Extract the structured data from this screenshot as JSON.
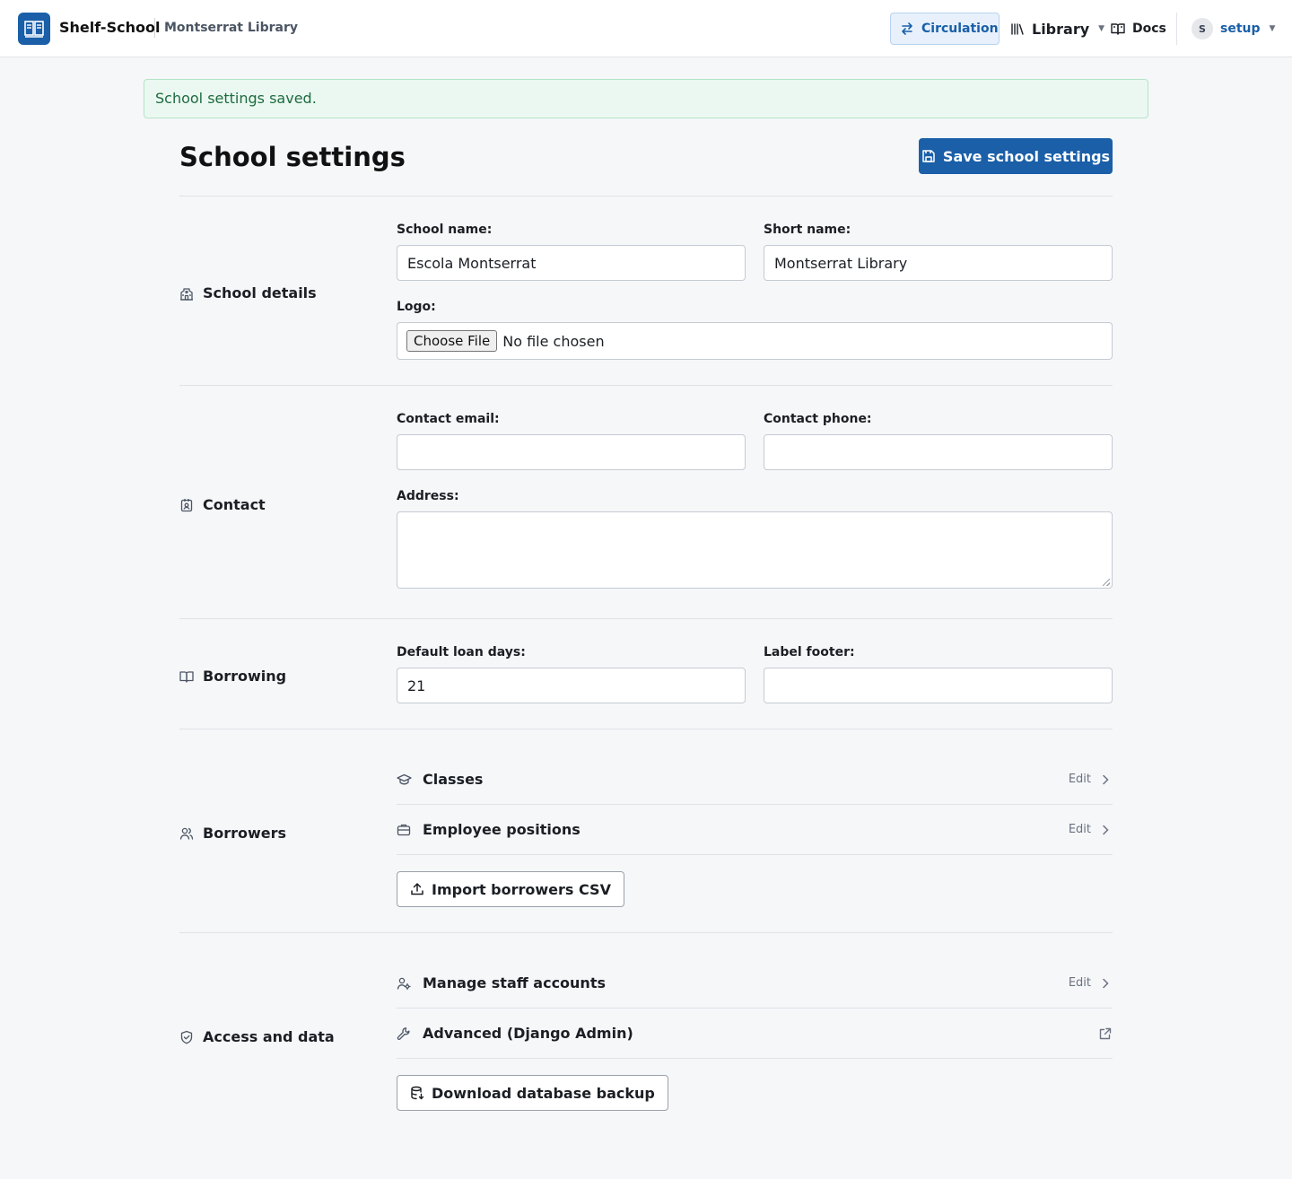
{
  "header": {
    "brand_name": "Shelf-School",
    "library_name": "Montserrat Library",
    "nav": {
      "circulation": "Circulation",
      "library": "Library",
      "docs": "Docs"
    },
    "user": {
      "initial": "S",
      "name": "setup"
    }
  },
  "alert": {
    "message": "School settings saved."
  },
  "page": {
    "title": "School settings",
    "save_label": "Save school settings"
  },
  "sections": {
    "school_details": {
      "label": "School details",
      "school_name_label": "School name:",
      "school_name_value": "Escola Montserrat",
      "short_name_label": "Short name:",
      "short_name_value": "Montserrat Library",
      "logo_label": "Logo:",
      "choose_file": "Choose File",
      "no_file": "No file chosen"
    },
    "contact": {
      "label": "Contact",
      "email_label": "Contact email:",
      "email_value": "",
      "phone_label": "Contact phone:",
      "phone_value": "",
      "address_label": "Address:",
      "address_value": ""
    },
    "borrowing": {
      "label": "Borrowing",
      "loan_days_label": "Default loan days:",
      "loan_days_value": "21",
      "label_footer_label": "Label footer:",
      "label_footer_value": ""
    },
    "borrowers": {
      "label": "Borrowers",
      "classes": "Classes",
      "employee_positions": "Employee positions",
      "edit": "Edit",
      "import_csv": "Import borrowers CSV"
    },
    "access": {
      "label": "Access and data",
      "staff_accounts": "Manage staff accounts",
      "django_admin": "Advanced (Django Admin)",
      "edit": "Edit",
      "backup": "Download database backup"
    }
  },
  "colors": {
    "primary": "#1a5fa8",
    "success_bg": "#ebf8f1",
    "success_text": "#1d6b3e",
    "page_bg": "#f6f7f9"
  }
}
